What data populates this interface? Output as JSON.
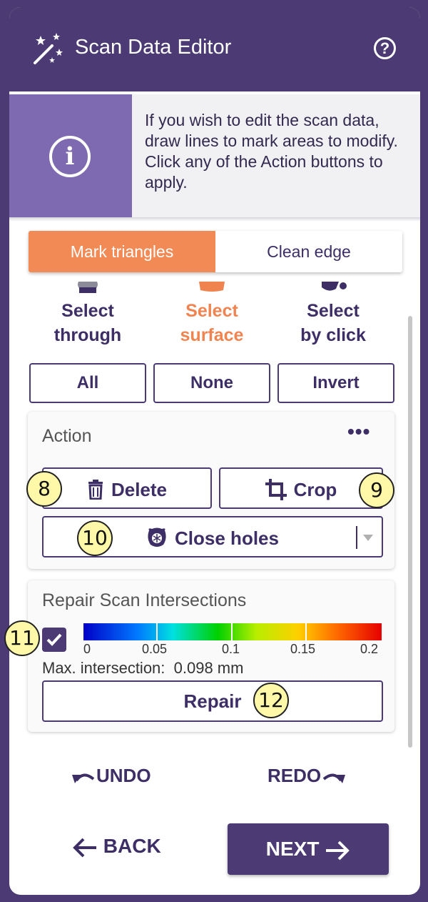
{
  "header": {
    "title": "Scan Data Editor",
    "help": "?"
  },
  "info": {
    "icon": "info-icon",
    "text": "If you wish to edit the scan data, draw lines to mark areas to modify. Click any of the Action buttons to apply."
  },
  "mode_tabs": [
    {
      "label": "Mark triangles",
      "active": true
    },
    {
      "label": "Clean edge",
      "active": false
    }
  ],
  "select_tools": [
    {
      "line1": "Select",
      "line2": "through",
      "icon": "select-through-icon",
      "active": false
    },
    {
      "line1": "Select",
      "line2": "surface",
      "icon": "select-surface-icon",
      "active": true
    },
    {
      "line1": "Select",
      "line2": "by click",
      "icon": "select-by-click-icon",
      "active": false
    }
  ],
  "selection_buttons": {
    "all": "All",
    "none": "None",
    "invert": "Invert"
  },
  "action": {
    "title": "Action",
    "more": "•••",
    "delete": "Delete",
    "crop": "Crop",
    "close_holes": "Close holes"
  },
  "repair": {
    "title": "Repair Scan Intersections",
    "checked": true,
    "scale": [
      "0",
      "0.05",
      "0.1",
      "0.15",
      "0.2"
    ],
    "max_label": "Max. intersection:",
    "max_value": "0.098 mm",
    "button": "Repair"
  },
  "history": {
    "undo": "UNDO",
    "redo": "REDO"
  },
  "nav": {
    "back": "BACK",
    "next": "NEXT"
  },
  "callouts": {
    "b8": "8",
    "b9": "9",
    "b10": "10",
    "b11": "11",
    "b12": "12"
  },
  "colors": {
    "primary": "#4b3a73",
    "accent": "#f28a55",
    "info_bg": "#7e6ab0"
  }
}
